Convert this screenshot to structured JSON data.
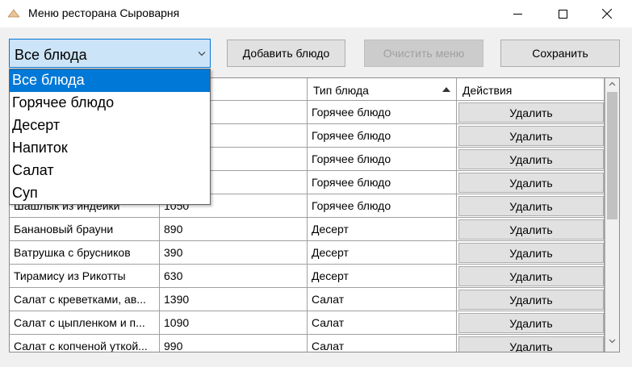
{
  "window": {
    "title": "Меню ресторана Сыроварня",
    "icons": {
      "app": "app-icon",
      "minimize": "minimize-icon",
      "maximize": "maximize-icon",
      "close": "close-icon"
    }
  },
  "filter": {
    "selected": "Все блюда",
    "options": [
      "Все блюда",
      "Горячее блюдо",
      "Десерт",
      "Напиток",
      "Салат",
      "Суп"
    ],
    "expanded": true
  },
  "toolbar": {
    "add_label": "Добавить блюдо",
    "clear_label": "Очистить меню",
    "clear_enabled": false,
    "save_label": "Сохранить"
  },
  "table": {
    "columns": [
      "",
      "",
      "Тип блюда",
      "Действия"
    ],
    "sort_column": "Тип блюда",
    "sort_direction": "ascending",
    "rows": [
      {
        "name": "",
        "price": "",
        "type": "Горячее блюдо",
        "action": "Удалить"
      },
      {
        "name": "",
        "price": "",
        "type": "Горячее блюдо",
        "action": "Удалить"
      },
      {
        "name": "",
        "price": "",
        "type": "Горячее блюдо",
        "action": "Удалить"
      },
      {
        "name": "",
        "price": "",
        "type": "Горячее блюдо",
        "action": "Удалить"
      },
      {
        "name": "Шашлык из индейки",
        "price": "1050",
        "type": "Горячее блюдо",
        "action": "Удалить"
      },
      {
        "name": "Банановый брауни",
        "price": "890",
        "type": "Десерт",
        "action": "Удалить"
      },
      {
        "name": "Ватрушка с брусников",
        "price": "390",
        "type": "Десерт",
        "action": "Удалить"
      },
      {
        "name": "Тирамису из Рикотты",
        "price": "630",
        "type": "Десерт",
        "action": "Удалить"
      },
      {
        "name": "Салат с креветками, ав...",
        "price": "1390",
        "type": "Салат",
        "action": "Удалить"
      },
      {
        "name": "Салат с цыпленком и п...",
        "price": "1090",
        "type": "Салат",
        "action": "Удалить"
      },
      {
        "name": "Салат с копченой уткой...",
        "price": "990",
        "type": "Салат",
        "action": "Удалить"
      }
    ]
  },
  "colors": {
    "accent": "#0078d7",
    "combo_background": "#cce4f7",
    "button_face": "#e1e1e1",
    "disabled_button": "#cccccc",
    "window_background": "#f0f0f0"
  }
}
